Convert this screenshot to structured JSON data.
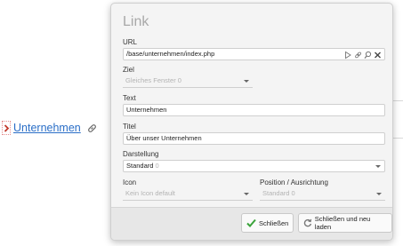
{
  "context": {
    "link_text": "Unternehmen",
    "link_color": "#2a6ec7"
  },
  "dialog": {
    "title": "Link",
    "url": {
      "label": "URL",
      "value": "/base/unternehmen/index.php",
      "icons": [
        "select-icon",
        "link-icon",
        "search-icon",
        "clear-icon"
      ]
    },
    "ziel": {
      "label": "Ziel",
      "value": "Gleiches Fenster 0"
    },
    "text": {
      "label": "Text",
      "value": "Unternehmen"
    },
    "titel": {
      "label": "Titel",
      "value": "Über unser Unternehmen"
    },
    "darstellung": {
      "label": "Darstellung",
      "value": "Standard",
      "suffix": "0"
    },
    "icon": {
      "label": "Icon",
      "value": "Kein Icon default"
    },
    "position": {
      "label": "Position / Ausrichtung",
      "value": "Standard 0"
    },
    "buttons": {
      "close": "Schließen",
      "close_reload": "Schließen und neu laden"
    },
    "accent_green": "#3aa33a"
  }
}
